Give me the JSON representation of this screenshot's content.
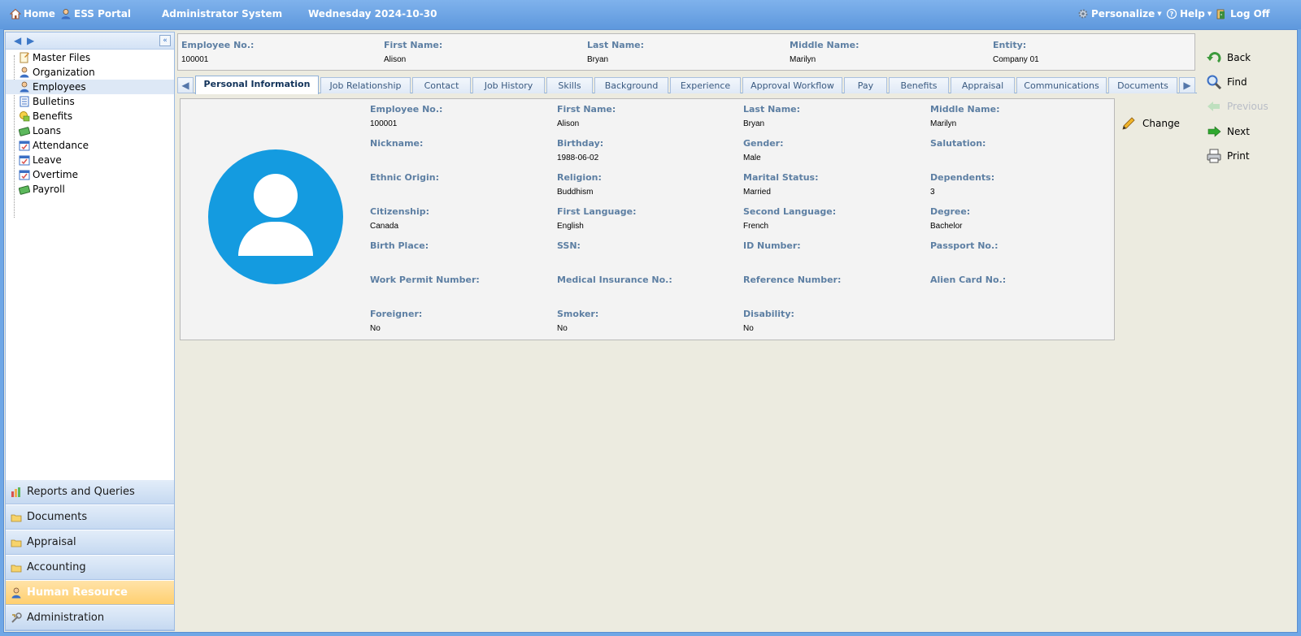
{
  "topbar": {
    "home": "Home",
    "ess_portal": "ESS Portal",
    "system": "Administrator System",
    "date": "Wednesday 2024-10-30",
    "personalize": "Personalize",
    "help": "Help",
    "logoff": "Log Off"
  },
  "sidebar": {
    "tree": [
      {
        "label": "Master Files",
        "icon": "master-files-icon"
      },
      {
        "label": "Organization",
        "icon": "organization-icon"
      },
      {
        "label": "Employees",
        "icon": "employees-icon"
      },
      {
        "label": "Bulletins",
        "icon": "bulletins-icon"
      },
      {
        "label": "Benefits",
        "icon": "benefits-icon"
      },
      {
        "label": "Loans",
        "icon": "loans-icon"
      },
      {
        "label": "Attendance",
        "icon": "attendance-icon"
      },
      {
        "label": "Leave",
        "icon": "leave-icon"
      },
      {
        "label": "Overtime",
        "icon": "overtime-icon"
      },
      {
        "label": "Payroll",
        "icon": "payroll-icon"
      }
    ],
    "selected": "Employees",
    "sections": [
      {
        "label": "Reports and Queries"
      },
      {
        "label": "Documents"
      },
      {
        "label": "Appraisal"
      },
      {
        "label": "Accounting"
      },
      {
        "label": "Human Resource"
      },
      {
        "label": "Administration"
      }
    ],
    "active_section": "Human Resource"
  },
  "summary": {
    "employee_no_label": "Employee No.:",
    "employee_no": "100001",
    "first_name_label": "First Name:",
    "first_name": "Alison",
    "last_name_label": "Last Name:",
    "last_name": "Bryan",
    "middle_name_label": "Middle Name:",
    "middle_name": "Marilyn",
    "entity_label": "Entity:",
    "entity": "Company 01"
  },
  "tabs": [
    {
      "label": "Personal Information"
    },
    {
      "label": "Job Relationship"
    },
    {
      "label": "Contact"
    },
    {
      "label": "Job History"
    },
    {
      "label": "Skills"
    },
    {
      "label": "Background"
    },
    {
      "label": "Experience"
    },
    {
      "label": "Approval Workflow"
    },
    {
      "label": "Pay"
    },
    {
      "label": "Benefits"
    },
    {
      "label": "Appraisal"
    },
    {
      "label": "Communications"
    },
    {
      "label": "Documents"
    }
  ],
  "active_tab": "Personal Information",
  "details": {
    "employee_no": {
      "label": "Employee No.:",
      "value": "100001"
    },
    "first_name": {
      "label": "First Name:",
      "value": "Alison"
    },
    "last_name": {
      "label": "Last Name:",
      "value": "Bryan"
    },
    "middle_name": {
      "label": "Middle Name:",
      "value": "Marilyn"
    },
    "nickname": {
      "label": "Nickname:",
      "value": ""
    },
    "birthday": {
      "label": "Birthday:",
      "value": "1988-06-02"
    },
    "gender": {
      "label": "Gender:",
      "value": "Male"
    },
    "salutation": {
      "label": "Salutation:",
      "value": ""
    },
    "ethnic_origin": {
      "label": "Ethnic Origin:",
      "value": ""
    },
    "religion": {
      "label": "Religion:",
      "value": "Buddhism"
    },
    "marital_status": {
      "label": "Marital Status:",
      "value": "Married"
    },
    "dependents": {
      "label": "Dependents:",
      "value": "3"
    },
    "citizenship": {
      "label": "Citizenship:",
      "value": "Canada"
    },
    "first_language": {
      "label": "First Language:",
      "value": "English"
    },
    "second_language": {
      "label": "Second Language:",
      "value": "French"
    },
    "degree": {
      "label": "Degree:",
      "value": "Bachelor"
    },
    "birth_place": {
      "label": "Birth Place:",
      "value": ""
    },
    "ssn": {
      "label": "SSN:",
      "value": ""
    },
    "id_number": {
      "label": "ID Number:",
      "value": ""
    },
    "passport_no": {
      "label": "Passport No.:",
      "value": ""
    },
    "work_permit": {
      "label": "Work Permit Number:",
      "value": ""
    },
    "medical_insurance": {
      "label": "Medical Insurance No.:",
      "value": ""
    },
    "reference_number": {
      "label": "Reference Number:",
      "value": ""
    },
    "alien_card": {
      "label": "Alien Card No.:",
      "value": ""
    },
    "foreigner": {
      "label": "Foreigner:",
      "value": "No"
    },
    "smoker": {
      "label": "Smoker:",
      "value": "No"
    },
    "disability": {
      "label": "Disability:",
      "value": "No"
    }
  },
  "change_label": "Change",
  "actions": {
    "back": "Back",
    "find": "Find",
    "previous": "Previous",
    "next": "Next",
    "print": "Print"
  },
  "colors": {
    "topbar": "#6fa7e6",
    "avatar": "#149be0",
    "label": "#5d7fa3",
    "active_section": "#ffcf70"
  }
}
